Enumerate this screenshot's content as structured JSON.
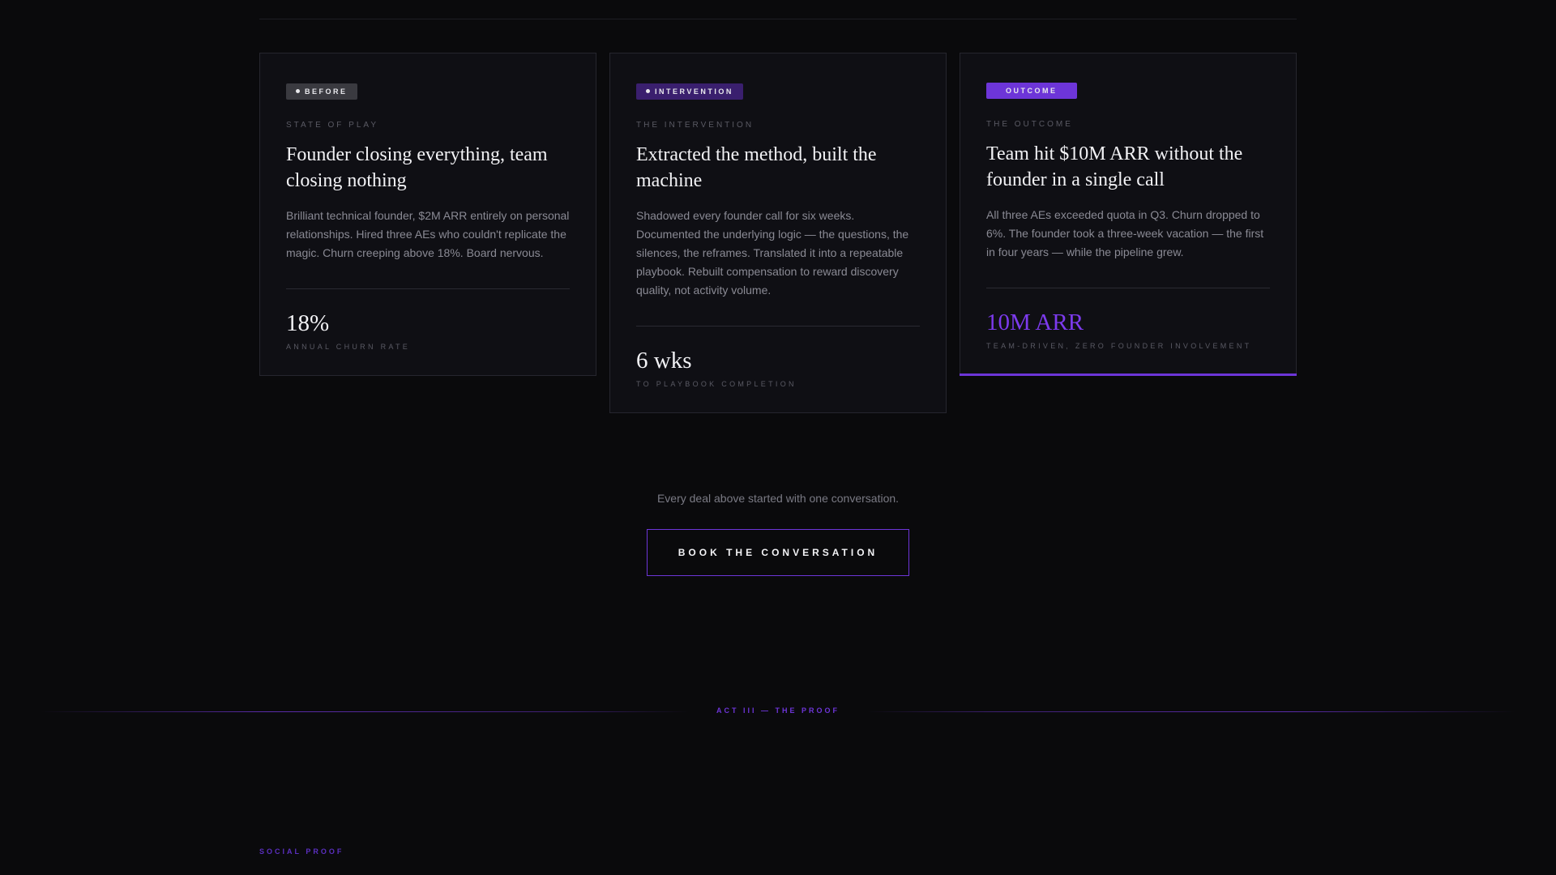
{
  "cards": [
    {
      "badge": "BEFORE",
      "eyebrow": "STATE OF PLAY",
      "title": "Founder closing everything, team closing nothing",
      "body": "Brilliant technical founder, $2M ARR entirely on personal relationships. Hired three AEs who couldn't replicate the magic. Churn creeping above 18%. Board nervous.",
      "metric": "18%",
      "metric_label": "ANNUAL CHURN RATE"
    },
    {
      "badge": "INTERVENTION",
      "eyebrow": "THE INTERVENTION",
      "title": "Extracted the method, built the machine",
      "body": "Shadowed every founder call for six weeks. Documented the underlying logic — the questions, the silences, the reframes. Translated it into a repeatable playbook. Rebuilt compensation to reward discovery quality, not activity volume.",
      "metric": "6 wks",
      "metric_label": "TO PLAYBOOK COMPLETION"
    },
    {
      "badge": "OUTCOME",
      "eyebrow": "THE OUTCOME",
      "title": "Team hit $10M ARR without the founder in a single call",
      "body": "All three AEs exceeded quota in Q3. Churn dropped to 6%. The founder took a three-week vacation — the first in four years — while the pipeline grew.",
      "metric": "10M ARR",
      "metric_label": "TEAM-DRIVEN, ZERO FOUNDER INVOLVEMENT"
    }
  ],
  "cta": {
    "caption": "Every deal above started with one conversation.",
    "button_label": "BOOK THE CONVERSATION"
  },
  "act_divider": {
    "label": "ACT III — THE PROOF"
  },
  "next_section": {
    "label": "SOCIAL PROOF"
  },
  "colors": {
    "accent": "#7c3aed",
    "background": "#0a0a0c",
    "card": "#0f0f14"
  }
}
